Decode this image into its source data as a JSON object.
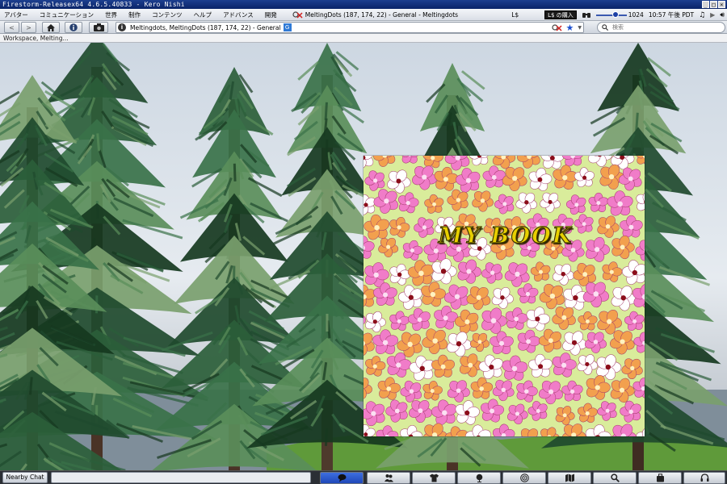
{
  "window": {
    "title": "Firestorm-Releasex64 4.6.5.40833 - Kero Nishi",
    "controls": [
      "_",
      "□",
      "×"
    ]
  },
  "menu": {
    "items": [
      "アバター",
      "コミュニケーション",
      "世界",
      "制作",
      "コンテンツ",
      "ヘルプ",
      "アドバンス",
      "開発"
    ],
    "location_title": "MeltingDots (187, 174, 22) - General - Meltingdots",
    "currency_symbol": "L$",
    "buy_label": "L$ の購入",
    "volume_value": "1024",
    "time": "10:57 午後 PDT"
  },
  "nav": {
    "back": "<",
    "forward": ">",
    "address": "Meltingdots, MeltingDots (187, 174, 22) - General",
    "maturity_badge": "G",
    "search_placeholder": "検索"
  },
  "workspace_label": "Workspace, Melting...",
  "book": {
    "title": "MY BOOK"
  },
  "bottom": {
    "nearby_chat_label": "Nearby Chat",
    "toolbar": [
      "chat",
      "people",
      "appearance",
      "places",
      "radar",
      "map",
      "search",
      "inventory",
      "voice"
    ]
  },
  "colors": {
    "title_bar": "#0a2468",
    "toolbar_active": "#1f47b8",
    "book_background": "#d9ec9b",
    "book_title": "#e8d000",
    "flower_pink": "#f07cc8",
    "flower_orange": "#f2a04e",
    "flower_white": "#ffffff"
  }
}
